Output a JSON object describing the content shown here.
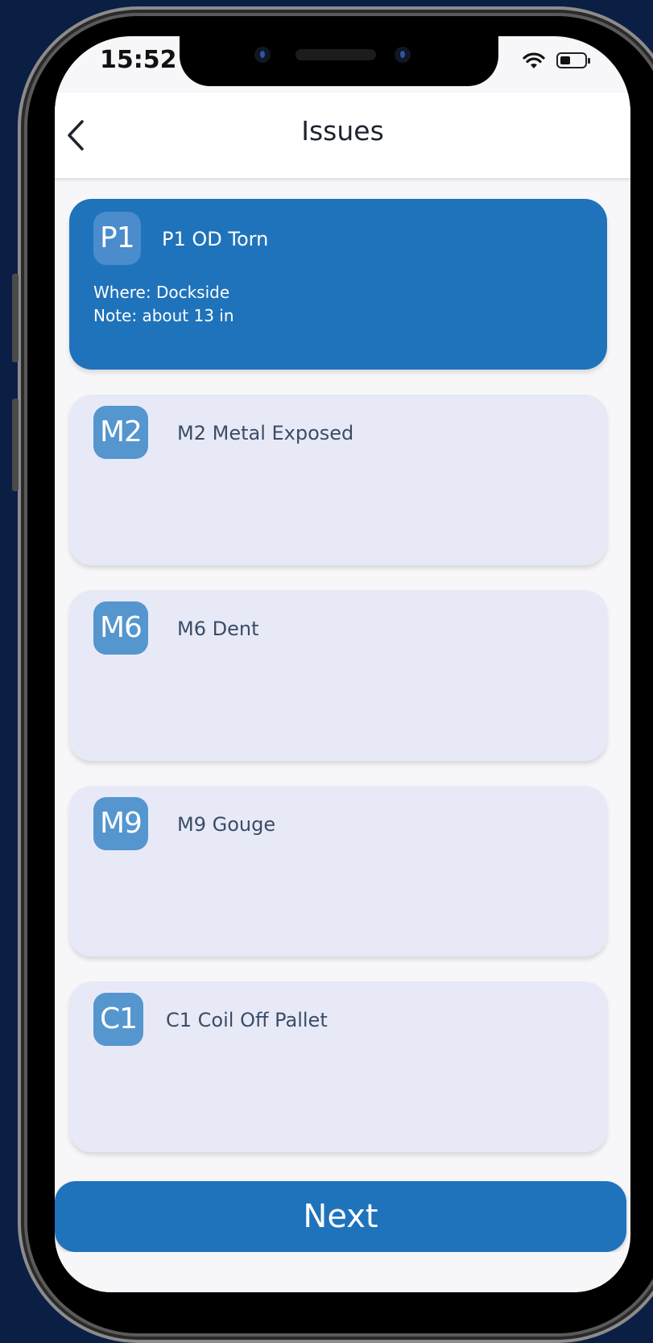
{
  "status_bar": {
    "time": "15:52",
    "icons": [
      "wifi-icon",
      "battery-icon"
    ]
  },
  "header": {
    "title": "Issues",
    "back_icon": "chevron-left-icon"
  },
  "issues": [
    {
      "code": "P1",
      "title": "P1 OD Torn",
      "where": "Where: Dockside",
      "note": "Note: about 13 in",
      "selected": true
    },
    {
      "code": "M2",
      "title": "M2 Metal Exposed",
      "selected": false
    },
    {
      "code": "M6",
      "title": "M6 Dent",
      "selected": false
    },
    {
      "code": "M9",
      "title": "M9 Gouge",
      "selected": false
    },
    {
      "code": "C1",
      "title": "C1 Coil Off Pallet",
      "selected": false
    }
  ],
  "footer": {
    "next_label": "Next"
  },
  "colors": {
    "primary": "#1f73bb",
    "card_bg": "#e8e9f7",
    "badge_bg": "#5596cf",
    "title_text": "#3a4d66",
    "background": "#0b1f45"
  }
}
